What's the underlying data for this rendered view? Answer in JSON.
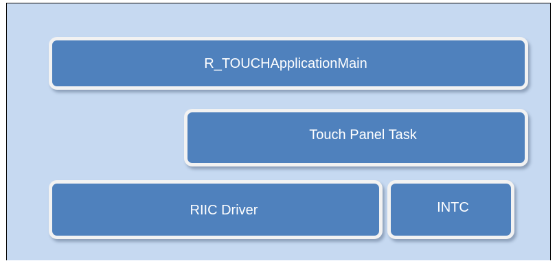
{
  "diagram": {
    "blocks": [
      {
        "label": "R_TOUCHApplicationMain"
      },
      {
        "label": "Touch Panel Task"
      },
      {
        "label": "RIIC Driver"
      },
      {
        "label": "INTC"
      }
    ]
  },
  "colors": {
    "background": "#c6d9f1",
    "block_fill": "#4f81bd",
    "block_border": "#f2f2f2",
    "text": "#ffffff"
  }
}
